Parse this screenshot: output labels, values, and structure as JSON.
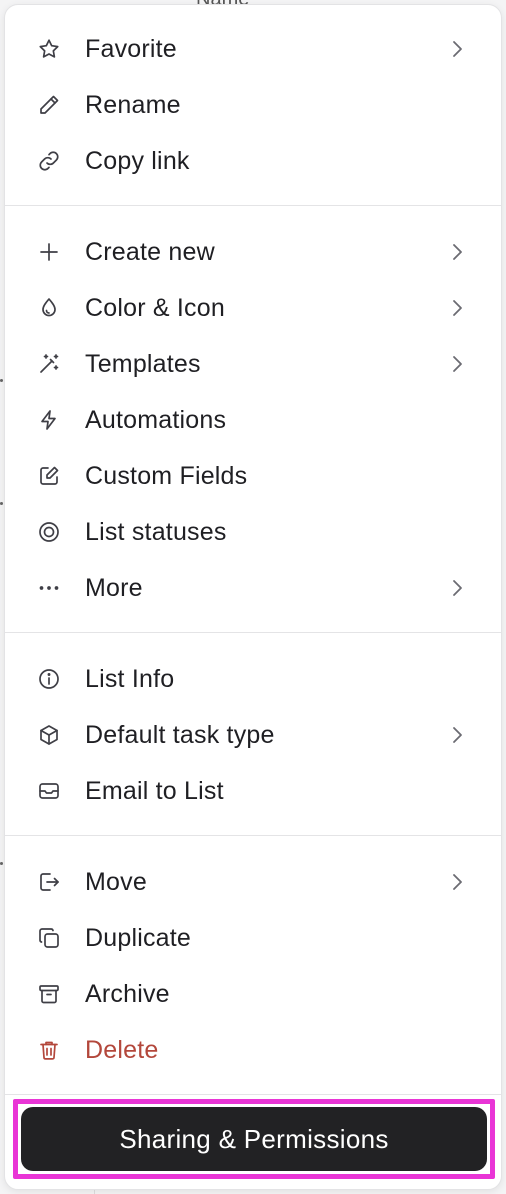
{
  "background": {
    "peek_text": "Name"
  },
  "menu": {
    "sections": [
      {
        "items": [
          {
            "icon": "star-icon",
            "label": "Favorite",
            "submenu": true
          },
          {
            "icon": "pencil-icon",
            "label": "Rename",
            "submenu": false
          },
          {
            "icon": "link-icon",
            "label": "Copy link",
            "submenu": false
          }
        ]
      },
      {
        "items": [
          {
            "icon": "plus-icon",
            "label": "Create new",
            "submenu": true
          },
          {
            "icon": "droplet-icon",
            "label": "Color & Icon",
            "submenu": true
          },
          {
            "icon": "magic-wand-icon",
            "label": "Templates",
            "submenu": true
          },
          {
            "icon": "lightning-icon",
            "label": "Automations",
            "submenu": false
          },
          {
            "icon": "edit-square-icon",
            "label": "Custom Fields",
            "submenu": false
          },
          {
            "icon": "target-circle-icon",
            "label": "List statuses",
            "submenu": false
          },
          {
            "icon": "more-dots-icon",
            "label": "More",
            "submenu": true
          }
        ]
      },
      {
        "items": [
          {
            "icon": "info-icon",
            "label": "List Info",
            "submenu": false
          },
          {
            "icon": "cube-icon",
            "label": "Default task type",
            "submenu": true
          },
          {
            "icon": "envelope-icon",
            "label": "Email to List",
            "submenu": false
          }
        ]
      },
      {
        "items": [
          {
            "icon": "move-out-icon",
            "label": "Move",
            "submenu": true
          },
          {
            "icon": "duplicate-icon",
            "label": "Duplicate",
            "submenu": false
          },
          {
            "icon": "archive-icon",
            "label": "Archive",
            "submenu": false
          },
          {
            "icon": "trash-icon",
            "label": "Delete",
            "submenu": false,
            "danger": true
          }
        ]
      }
    ],
    "footer": {
      "button_label": "Sharing & Permissions"
    }
  },
  "colors": {
    "danger": "#b3473b",
    "button_bg": "#222224",
    "highlight": "#e935d6"
  }
}
